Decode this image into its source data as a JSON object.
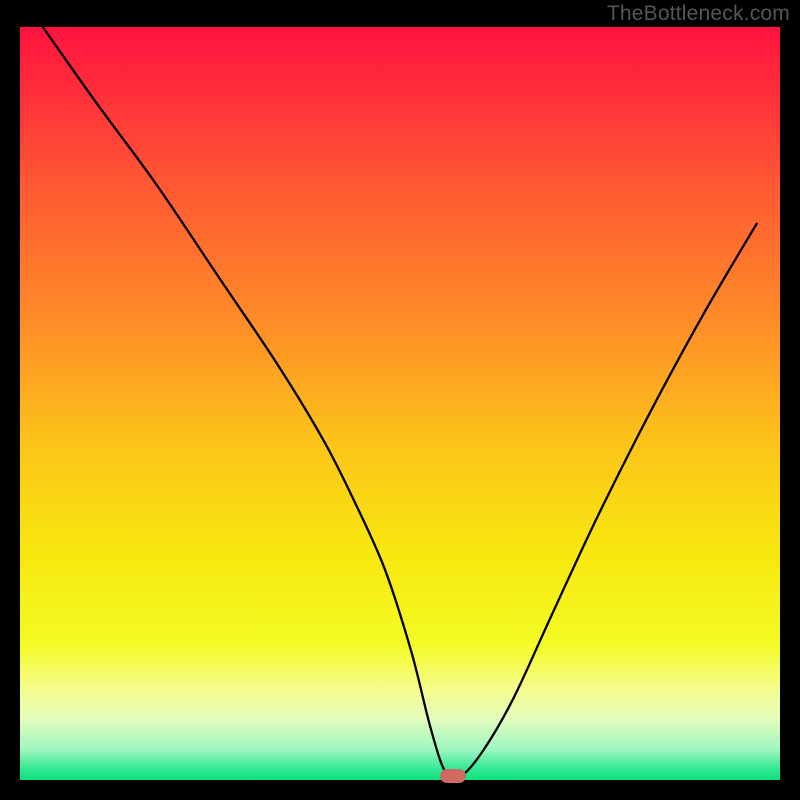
{
  "watermark": "TheBottleneck.com",
  "chart_data": {
    "type": "line",
    "title": "",
    "xlabel": "",
    "ylabel": "",
    "xlim": [
      0,
      100
    ],
    "ylim": [
      0,
      100
    ],
    "grid": false,
    "legend": false,
    "series": [
      {
        "name": "curve",
        "x": [
          3,
          10,
          18,
          26,
          34,
          40,
          44,
          48,
          51.5,
          54,
          56,
          58,
          61,
          65,
          70,
          76,
          83,
          90,
          97
        ],
        "values": [
          100,
          90,
          79,
          67,
          55,
          45,
          37,
          28,
          17,
          7,
          1,
          0.5,
          4,
          11,
          22,
          35,
          49,
          62,
          74
        ]
      }
    ],
    "annotation": {
      "name": "min-marker",
      "x": 57,
      "y": 0.5,
      "color": "#cf6a63"
    },
    "background_gradient": {
      "stops": [
        {
          "offset": 0.0,
          "color": "#ff123f"
        },
        {
          "offset": 0.2,
          "color": "#ff5534"
        },
        {
          "offset": 0.4,
          "color": "#fe8f27"
        },
        {
          "offset": 0.55,
          "color": "#fcc31a"
        },
        {
          "offset": 0.7,
          "color": "#f7e80f"
        },
        {
          "offset": 0.82,
          "color": "#f4fb25"
        },
        {
          "offset": 0.88,
          "color": "#f6fd8f"
        },
        {
          "offset": 0.92,
          "color": "#e1fcbd"
        },
        {
          "offset": 0.96,
          "color": "#9cf6c0"
        },
        {
          "offset": 0.985,
          "color": "#32e994"
        },
        {
          "offset": 1.0,
          "color": "#0ce47e"
        }
      ]
    }
  }
}
